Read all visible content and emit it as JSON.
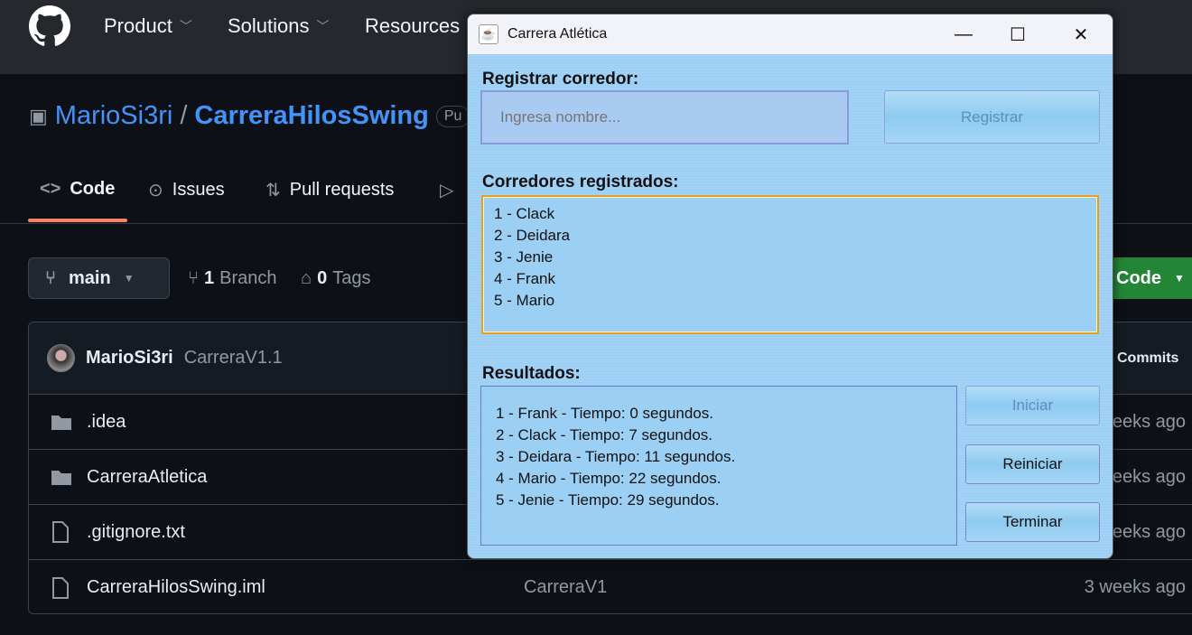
{
  "github": {
    "nav": [
      "Product",
      "Solutions",
      "Resources"
    ],
    "owner": "MarioSi3ri",
    "separator": "/",
    "repo": "CarreraHilosSwing",
    "visibility_badge": "Pu",
    "tabs": [
      "Code",
      "Issues",
      "Pull requests"
    ],
    "branch": "main",
    "branch_count": "1",
    "branch_label": "Branch",
    "tag_count": "0",
    "tag_label": "Tags",
    "code_button": "Code",
    "commit": {
      "author": "MarioSi3ri",
      "message": "CarreraV1.1",
      "commits_label": "Commits"
    },
    "files": [
      {
        "name": ".idea",
        "type": "folder",
        "message": "",
        "age": "eeks ago"
      },
      {
        "name": "CarreraAtletica",
        "type": "folder",
        "message": "",
        "age": "eeks ago"
      },
      {
        "name": ".gitignore.txt",
        "type": "file",
        "message": "",
        "age": "eeks ago"
      },
      {
        "name": "CarreraHilosSwing.iml",
        "type": "file",
        "message": "CarreraV1",
        "age": "3 weeks ago"
      }
    ]
  },
  "dialog": {
    "title": "Carrera Atlética",
    "register_label": "Registrar corredor:",
    "name_placeholder": "Ingresa nombre...",
    "register_button": "Registrar",
    "runners_label": "Corredores registrados:",
    "runners": [
      "1 - Clack",
      "2 - Deidara",
      "3 - Jenie",
      "4 - Frank",
      "5 - Mario"
    ],
    "results_label": "Resultados:",
    "results": [
      "1 - Frank - Tiempo: 0 segundos.",
      "2 - Clack - Tiempo: 7 segundos.",
      "3 - Deidara - Tiempo: 11 segundos.",
      "4 - Mario - Tiempo: 22 segundos.",
      "5 - Jenie - Tiempo: 29 segundos."
    ],
    "buttons": {
      "start": "Iniciar",
      "restart": "Reiniciar",
      "finish": "Terminar"
    }
  },
  "colors": {
    "github_bg": "#0d1117",
    "accent_blue": "#4493f8",
    "tab_underline": "#f78166",
    "green": "#238636",
    "dialog_bg": "#a2d2f6",
    "focus_border": "#e5a020"
  }
}
